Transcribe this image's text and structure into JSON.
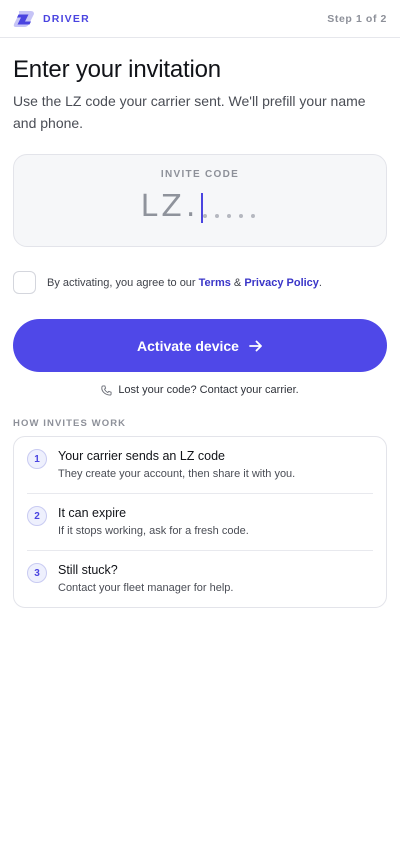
{
  "header": {
    "brand": "DRIVER",
    "logo_icon": "lz-logo-icon",
    "step": "Step 1 of 2"
  },
  "page": {
    "title": "Enter your invitation",
    "subtitle": "Use the LZ code your carrier sent. We'll prefill your name and phone."
  },
  "invite_code": {
    "label": "INVITE CODE",
    "prefix": "LZ.",
    "value": "",
    "slots": 5
  },
  "agreement": {
    "checked": false,
    "text_before": "By activating, you agree to our ",
    "terms": "Terms",
    "amp": " & ",
    "privacy": "Privacy Policy",
    "text_after": "."
  },
  "activate": {
    "label": "Activate device",
    "icon": "arrow-right-icon"
  },
  "help": {
    "icon": "phone-icon",
    "text": "Lost your code? Contact your carrier."
  },
  "how_invites": {
    "title": "HOW INVITES WORK",
    "items": [
      {
        "num": "1",
        "title": "Your carrier sends an LZ code",
        "desc": "They create your account, then share it with you."
      },
      {
        "num": "2",
        "title": "It can expire",
        "desc": "If it stops working, ask for a fresh code."
      },
      {
        "num": "3",
        "title": "Still stuck?",
        "desc": "Contact your fleet manager for help."
      }
    ]
  },
  "colors": {
    "accent": "#4f48e8",
    "accent_text": "#4a44e0",
    "muted": "#8d9099",
    "card_bg": "#f6f7f9"
  }
}
